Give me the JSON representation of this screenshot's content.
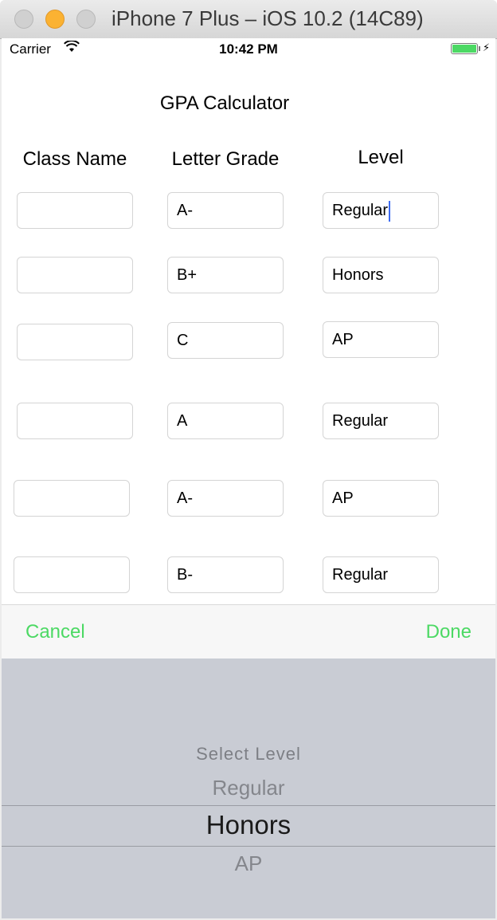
{
  "window": {
    "title": "iPhone 7 Plus – iOS 10.2 (14C89)"
  },
  "status_bar": {
    "carrier": "Carrier",
    "time": "10:42 PM",
    "battery_icon": "battery-icon",
    "wifi_icon": "wifi-icon"
  },
  "app": {
    "title": "GPA Calculator",
    "headers": {
      "class_name": "Class Name",
      "letter_grade": "Letter Grade",
      "level": "Level"
    },
    "rows": [
      {
        "class_name": "",
        "letter_grade": "A-",
        "level": "Regular"
      },
      {
        "class_name": "",
        "letter_grade": "B+",
        "level": "Honors"
      },
      {
        "class_name": "",
        "letter_grade": "C",
        "level": "AP"
      },
      {
        "class_name": "",
        "letter_grade": "A",
        "level": "Regular"
      },
      {
        "class_name": "",
        "letter_grade": "A-",
        "level": "AP"
      },
      {
        "class_name": "",
        "letter_grade": "B-",
        "level": "Regular"
      }
    ]
  },
  "toolbar": {
    "cancel_label": "Cancel",
    "done_label": "Done",
    "accent_color": "#4cd964"
  },
  "picker": {
    "options": [
      "Select Level",
      "Regular",
      "Honors",
      "AP"
    ],
    "selected": "Honors"
  }
}
